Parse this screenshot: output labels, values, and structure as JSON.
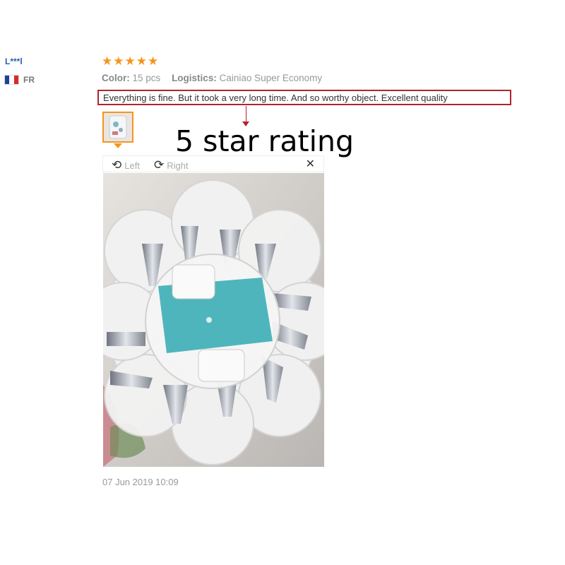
{
  "reviewer": {
    "name": "L***l",
    "country": "FR",
    "flag_colors": [
      "#1f3f9a",
      "#ffffff",
      "#d62a2a"
    ]
  },
  "rating": {
    "stars": 5,
    "max": 5,
    "star_glyph": "★",
    "color": "#f7941d"
  },
  "meta": {
    "color_label": "Color:",
    "color_value": "15 pcs",
    "logistics_label": "Logistics:",
    "logistics_value": "Cainiao Super Economy"
  },
  "review_text": "Everything is fine. But it took a very long time. And so worthy object. Excellent quality",
  "annotation": {
    "text": "5 star rating",
    "highlight_color": "#b22330"
  },
  "viewer": {
    "rotate_left_icon": "⟲",
    "left_label": "Left",
    "rotate_right_icon": "⟳",
    "right_label": "Right",
    "close_icon": "✕"
  },
  "photo": {
    "subject": "piping-nozzle-case-icon"
  },
  "date": "07 Jun 2019 10:09"
}
